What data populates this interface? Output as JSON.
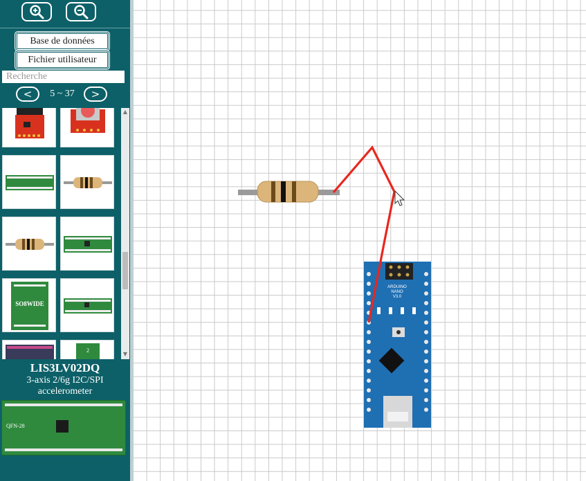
{
  "toolbar": {
    "zoom_in_icon": "magnifier-plus-icon",
    "zoom_out_icon": "magnifier-minus-icon"
  },
  "library": {
    "database_label": "Base de données",
    "user_file_label": "Fichier utilisateur",
    "search_placeholder": "Recherche",
    "prev_icon": "arrow-left-icon",
    "next_icon": "arrow-right-icon",
    "page_range": "5 ~ 37"
  },
  "components": [
    {
      "id": "breakout-red-1",
      "label": ""
    },
    {
      "id": "pushbutton-red",
      "label": ""
    },
    {
      "id": "pin-header-green",
      "label": ""
    },
    {
      "id": "resistor-1",
      "label": ""
    },
    {
      "id": "resistor-2",
      "label": ""
    },
    {
      "id": "pin-header-green-2",
      "label": ""
    },
    {
      "id": "so8wide-module",
      "label": "SO8WIDE"
    },
    {
      "id": "pin-header-green-3",
      "label": ""
    },
    {
      "id": "breakout-dark",
      "label": ""
    },
    {
      "id": "small-green",
      "label": "2"
    }
  ],
  "detail": {
    "title": "LIS3LV02DQ",
    "description": "3-axis 2/6g I2C/SPI accelerometer",
    "image_label": "QFN-28"
  },
  "canvas": {
    "board_label_1": "ARDUINO",
    "board_label_2": "NANO",
    "board_label_3": "V3.0",
    "wire_color": "#e8271e",
    "board_color": "#1f6fb3"
  },
  "colors": {
    "sidebar_bg": "#0d6068",
    "grid_line": "#c9c9c9"
  }
}
